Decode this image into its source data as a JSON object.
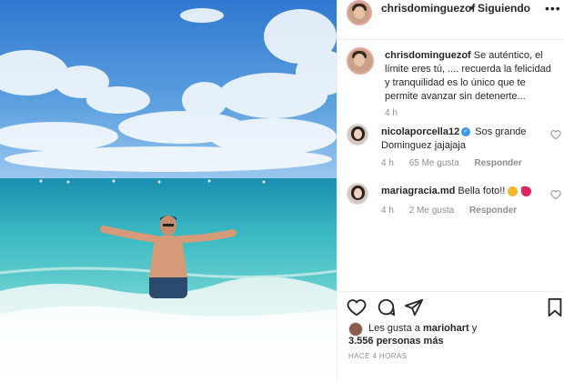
{
  "header": {
    "username": "chrisdominguezof",
    "separator": "•",
    "follow_status": "Siguiendo",
    "more_icon": "more-horizontal-icon"
  },
  "caption": {
    "username": "chrisdominguezof",
    "text": "Se auténtico, el límite eres tú, .... recuerda la felicidad y tranquilidad es lo único que te permite avanzar sin detenerte...",
    "time": "4 h"
  },
  "comments": [
    {
      "username": "nicolaporcella12",
      "verified": true,
      "text": "Sos grande Dominguez jajajaja",
      "time": "4 h",
      "likes": "65 Me gusta",
      "reply": "Responder"
    },
    {
      "username": "mariagracia.md",
      "verified": false,
      "text": "Bella foto!!",
      "emojis": [
        "heart-eyes-emoji",
        "heart-emoji"
      ],
      "time": "4 h",
      "likes": "2 Me gusta",
      "reply": "Responder"
    }
  ],
  "actions": {
    "icons": [
      "heart-icon",
      "comment-icon",
      "share-icon",
      "bookmark-icon"
    ]
  },
  "likes": {
    "prefix": "Les gusta a",
    "user": "mariohart",
    "connector": "y",
    "count": "3.556 personas más"
  },
  "posted": "HACE 4 HORAS",
  "colors": {
    "text": "#262626",
    "muted": "#8e8e8e",
    "verified": "#3897f0",
    "sky": "#4a8fd6",
    "sea": "#4ec6c8"
  }
}
